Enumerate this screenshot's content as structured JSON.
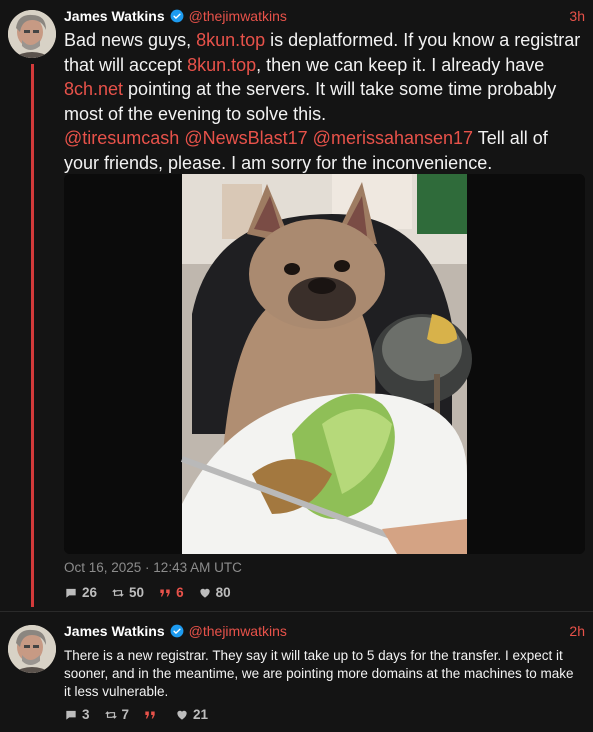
{
  "tweets": [
    {
      "author": "James Watkins",
      "handle": "@thejimwatkins",
      "time": "3h",
      "text": [
        {
          "t": "Bad news guys, "
        },
        {
          "t": "8kun.top",
          "link": true
        },
        {
          "t": " is deplatformed. If you know a registrar that will accept "
        },
        {
          "t": "8kun.top",
          "link": true
        },
        {
          "t": ", then we can keep it.  I already have "
        },
        {
          "t": "8ch.net",
          "link": true
        },
        {
          "t": " pointing at the servers. It will take some time probably most of the evening to solve this."
        },
        {
          "br": true
        },
        {
          "t": "@tiresumcash",
          "link": true
        },
        {
          "t": " "
        },
        {
          "t": "@NewsBlast17",
          "link": true
        },
        {
          "t": " "
        },
        {
          "t": "@merissahansen17",
          "link": true
        },
        {
          "t": " Tell all of your friends, please. I am sorry for the inconvenience."
        }
      ],
      "date": "Oct 16, 2025 · 12:43 AM UTC",
      "stats": {
        "replies": "26",
        "retweets": "50",
        "quotes": "6",
        "likes": "80"
      }
    },
    {
      "author": "James Watkins",
      "handle": "@thejimwatkins",
      "time": "2h",
      "text": "There is a new registrar. They say it will take up to 5 days for the transfer. I expect it sooner, and in the meantime, we are pointing more domains at the machines to make it less vulnerable.",
      "stats": {
        "replies": "3",
        "retweets": "7",
        "quotes": "",
        "likes": "21"
      }
    }
  ],
  "colors": {
    "accent": "#e8524a",
    "thread": "#d33a3a",
    "verified": "#1d9bf0",
    "background": "#141414"
  }
}
